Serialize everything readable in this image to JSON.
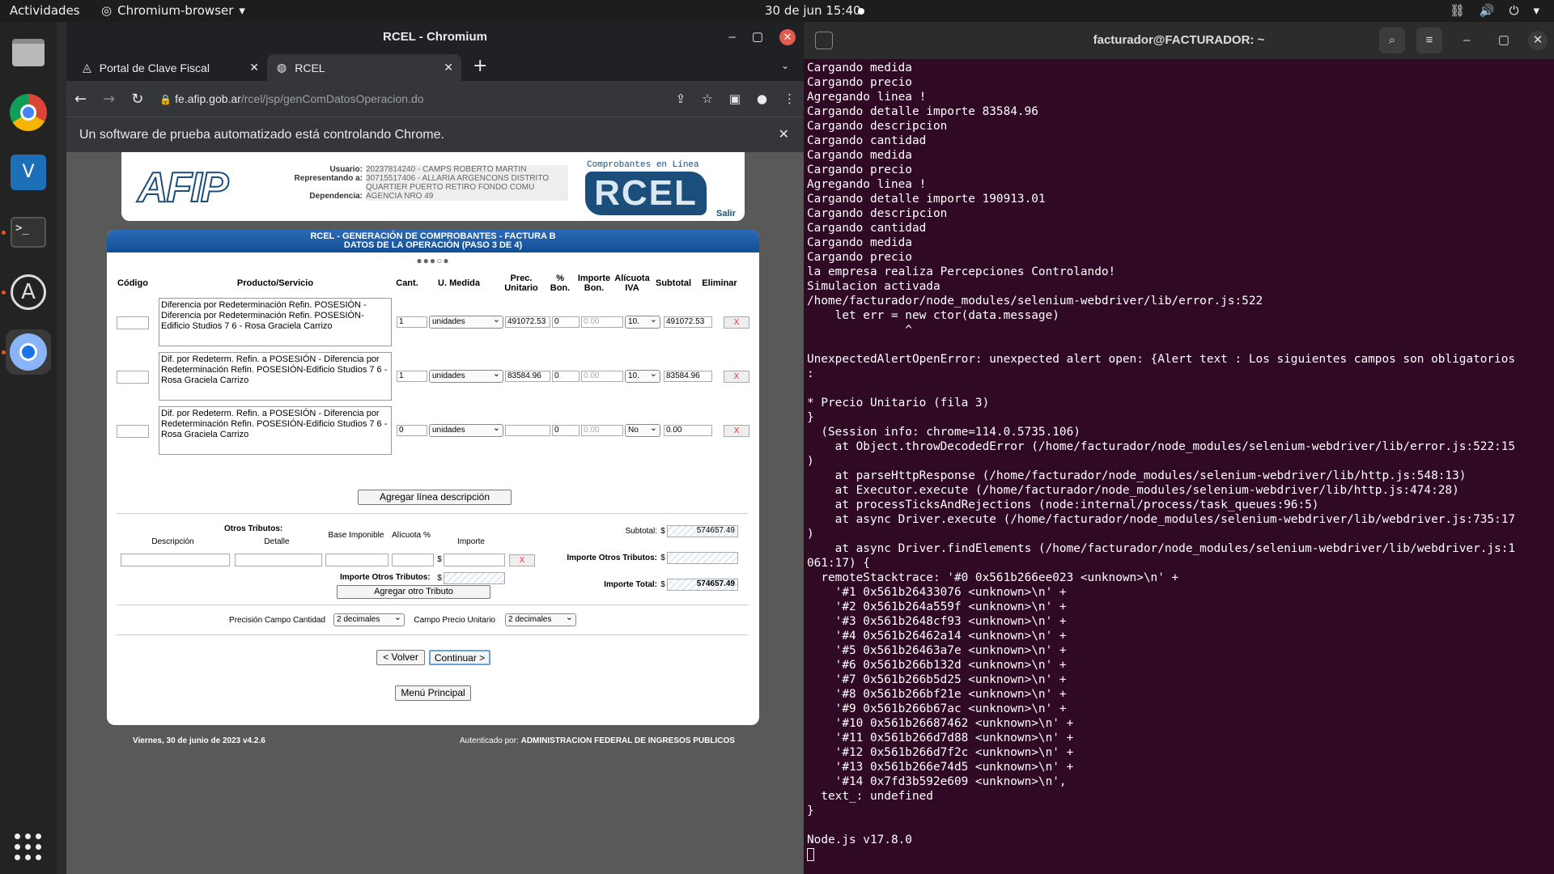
{
  "topbar": {
    "activities": "Actividades",
    "app": "Chromium-browser",
    "clock": "30 de jun  15:40"
  },
  "dock": {
    "items": [
      "files-icon",
      "chrome-icon",
      "vscode-icon",
      "terminal-icon",
      "software-icon",
      "chromium-icon"
    ]
  },
  "chrome": {
    "title": "RCEL - Chromium",
    "tabs": [
      {
        "label": "Portal de Clave Fiscal"
      },
      {
        "label": "RCEL"
      }
    ],
    "url_host": "fe.afip.gob.ar",
    "url_path": "/rcel/jsp/genComDatosOperacion.do",
    "infobar": "Un software de prueba automatizado está controlando Chrome."
  },
  "afip": {
    "logo": "AFIP",
    "usuario_label": "Usuario:",
    "usuario": "20237814240 - CAMPS ROBERTO MARTIN",
    "representando_label": "Representando a:",
    "representando": "30715517406 - ALLARIA ARGENCONS DISTRITO QUARTIER PUERTO RETIRO FONDO COMU",
    "dependencia_label": "Dependencia:",
    "dependencia": "AGENCIA NRO 49",
    "rcel_caption": "Comprobantes en Línea",
    "rcel_logo": "RCEL",
    "salir": "Salir"
  },
  "form": {
    "title": "RCEL - GENERACIÓN DE COMPROBANTES - FACTURA B",
    "subtitle": "DATOS DE LA OPERACIÓN (PASO 3 DE 4)",
    "steps": "●●●○●",
    "headers": {
      "codigo": "Código",
      "producto": "Producto/Servicio",
      "cant": "Cant.",
      "umedida": "U. Medida",
      "prec": "Prec. Unitario",
      "bon": "% Bon.",
      "impbon": "Importe Bon.",
      "alicuota": "Alícuota IVA",
      "subtotal": "Subtotal",
      "eliminar": "Eliminar"
    },
    "rows": [
      {
        "codigo": "",
        "desc": "Diferencia por Redeterminación Refin. POSESIÓN - Diferencia por Redeterminación Refin. POSESIÓN-Edificio Studios 7 6 - Rosa Graciela Carrizo",
        "cant": "1",
        "umedida": "unidades",
        "prec": "491072.53",
        "bon": "0",
        "impbon": "0.00",
        "alicuota": "10.",
        "subtotal": "491072.53",
        "x": "X"
      },
      {
        "codigo": "",
        "desc": "Dif. por Redeterm. Refin. a POSESIÓN - Diferencia por Redeterminación Refin. POSESIÓN-Edificio Studios 7 6 - Rosa Graciela Carrizo",
        "cant": "1",
        "umedida": "unidades",
        "prec": "83584.96",
        "bon": "0",
        "impbon": "0.00",
        "alicuota": "10.",
        "subtotal": "83584.96",
        "x": "X"
      },
      {
        "codigo": "",
        "desc": "Dif. por Redeterm. Refin. a POSESIÓN - Diferencia por Redeterminación Refin. POSESIÓN-Edificio Studios 7 6 - Rosa Graciela Carrizo",
        "cant": "0",
        "umedida": "unidades",
        "prec": "",
        "bon": "0",
        "impbon": "0.00",
        "alicuota": "No",
        "subtotal": "0.00",
        "x": "X"
      }
    ],
    "agregar_linea": "Agregar línea descripción",
    "otros_tributos": "Otros Tributos:",
    "trib_headers": {
      "desc": "Descripción",
      "detalle": "Detalle",
      "base": "Base Imponible",
      "alicuota": "Alícuota %",
      "importe": "Importe"
    },
    "currency": "$",
    "trib_x": "X",
    "importe_otros_label": "Importe Otros Tributos:",
    "agregar_tributo": "Agregar otro Tributo",
    "subtotal_label": "Subtotal:",
    "subtotal": "574657.49",
    "importe_otros_label2": "Importe Otros Tributos:",
    "importe_total_label": "Importe Total:",
    "importe_total": "574657.49",
    "precision_cant_label": "Precisión Campo Cantidad",
    "precision_cant": "2 decimales",
    "precision_prec_label": "Campo Precio Unitario",
    "precision_prec": "2 decimales",
    "volver": "< Volver",
    "continuar": "Continuar >",
    "menu": "Menú Principal",
    "footer_left": "Viernes, 30 de junio de 2023 v4.2.6",
    "footer_right_prefix": "Autenticado por:",
    "footer_right": "ADMINISTRACION FEDERAL DE INGRESOS PUBLICOS"
  },
  "terminal": {
    "title": "facturador@FACTURADOR: ~",
    "lines": [
      "Cargando medida",
      "Cargando precio",
      "Agregando linea !",
      "Cargando detalle importe 83584.96",
      "Cargando descripcion",
      "Cargando cantidad",
      "Cargando medida",
      "Cargando precio",
      "Agregando linea !",
      "Cargando detalle importe 190913.01",
      "Cargando descripcion",
      "Cargando cantidad",
      "Cargando medida",
      "Cargando precio",
      "la empresa realiza Percepciones Controlando!",
      "Simulacion activada",
      "/home/facturador/node_modules/selenium-webdriver/lib/error.js:522",
      "    let err = new ctor(data.message)",
      "              ^",
      "",
      "UnexpectedAlertOpenError: unexpected alert open: {Alert text : Los siguientes campos son obligatorios",
      ":",
      "",
      "* Precio Unitario (fila 3)",
      "}",
      "  (Session info: chrome=114.0.5735.106)",
      "    at Object.throwDecodedError (/home/facturador/node_modules/selenium-webdriver/lib/error.js:522:15",
      ")",
      "    at parseHttpResponse (/home/facturador/node_modules/selenium-webdriver/lib/http.js:548:13)",
      "    at Executor.execute (/home/facturador/node_modules/selenium-webdriver/lib/http.js:474:28)",
      "    at processTicksAndRejections (node:internal/process/task_queues:96:5)",
      "    at async Driver.execute (/home/facturador/node_modules/selenium-webdriver/lib/webdriver.js:735:17",
      ")",
      "    at async Driver.findElements (/home/facturador/node_modules/selenium-webdriver/lib/webdriver.js:1",
      "061:17) {",
      "  remoteStacktrace: '#0 0x561b266ee023 <unknown>\\n' +",
      "    '#1 0x561b26433076 <unknown>\\n' +",
      "    '#2 0x561b264a559f <unknown>\\n' +",
      "    '#3 0x561b2648cf93 <unknown>\\n' +",
      "    '#4 0x561b26462a14 <unknown>\\n' +",
      "    '#5 0x561b26463a7e <unknown>\\n' +",
      "    '#6 0x561b266b132d <unknown>\\n' +",
      "    '#7 0x561b266b5d25 <unknown>\\n' +",
      "    '#8 0x561b266bf21e <unknown>\\n' +",
      "    '#9 0x561b266b67ac <unknown>\\n' +",
      "    '#10 0x561b26687462 <unknown>\\n' +",
      "    '#11 0x561b266d7d88 <unknown>\\n' +",
      "    '#12 0x561b266d7f2c <unknown>\\n' +",
      "    '#13 0x561b266e74d5 <unknown>\\n' +",
      "    '#14 0x7fd3b592e609 <unknown>\\n',",
      "  text_: undefined",
      "}",
      "",
      "Node.js v17.8.0"
    ]
  }
}
